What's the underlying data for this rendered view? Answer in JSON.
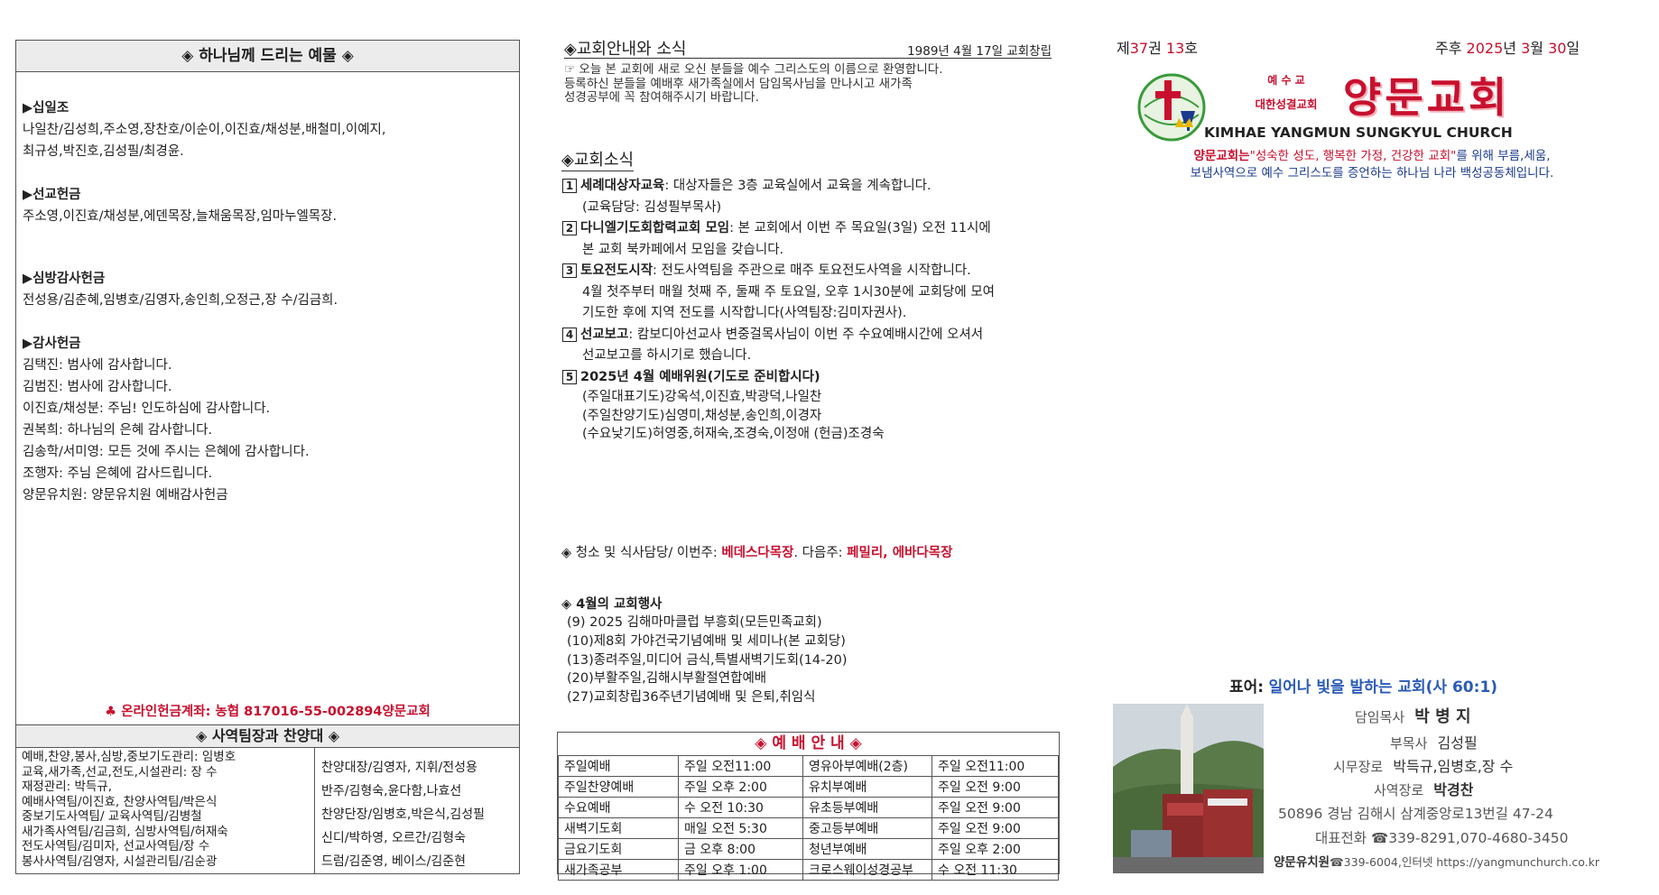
{
  "offering": {
    "title": "◈ 하나님께 드리는 예물 ◈",
    "sections": [
      {
        "heading": "▶십일조",
        "lines": [
          "나일찬/김성희,주소영,장찬호/이순이,이진효/채성분,배철미,이예지,",
          "최규성,박진호,김성필/최경윤."
        ]
      },
      {
        "heading": "▶선교헌금",
        "lines": [
          "주소영,이진효/채성분,에덴목장,늘채움목장,임마누엘목장."
        ]
      },
      {
        "heading": "▶심방감사헌금",
        "lines": [
          "전성용/김춘혜,임병호/김영자,송인희,오정근,장  수/김금희."
        ]
      },
      {
        "heading": "▶감사헌금",
        "lines": [
          "김택진: 범사에 감사합니다.",
          "김범진: 범사에 감사합니다.",
          "이진효/채성분: 주님! 인도하심에 감사합니다.",
          "권복희: 하나님의 은혜 감사합니다.",
          "김송학/서미영: 모든 것에 주시는 은혜에 감사합니다.",
          "조행자: 주님 은혜에 감사드립니다.",
          "양문유치원: 양문유치원 예배감사헌금"
        ]
      }
    ],
    "online_account": "♣ 온라인헌금계좌: 농협 817016-55-002894양문교회"
  },
  "ministry": {
    "title": "◈ 사역팀장과 찬양대 ◈",
    "left_lines": [
      "예배,찬양,봉사,심방,중보기도관리: 임병호",
      "교육,새가족,선교,전도,시설관리: 장  수",
      "재정관리: 박득규,",
      "예배사역팀/이진효,       찬양사역팀/박은식",
      "중보기도사역팀/            교육사역팀/김병철",
      "새가족사역팀/김금희,     심방사역팀/허재숙",
      "전도사역팀/김미자,         선교사역팀/장  수",
      "봉사사역팀/김영자,         시설관리팀/김순광"
    ],
    "right_lines": [
      "찬양대장/김영자, 지휘/전성용",
      "반주/김형숙,윤다함,나효선",
      "찬양단장/임병호,박은식,김성필",
      "신디/박하영,    오르간/김형숙",
      "드럼/김준영,    베이스/김준현"
    ]
  },
  "news": {
    "title": "◈교회안내와 소식",
    "founded": "1989년 4월 17일 교회창립",
    "welcome_lines": [
      "☞ 오늘 본 교회에 새로 오신 분들을 예수 그리스도의 이름으로 환영합니다.",
      "등록하신 분들을 예배후 새가족실에서 담임목사님을 만나시고 새가족",
      "성경공부에 꼭 참여해주시기 바랍니다."
    ],
    "sub_title": "◈교회소식",
    "items": [
      {
        "no": "1",
        "head": "세례대상자교육",
        "lines": [
          ": 대상자들은 3층 교육실에서 교육을 계속합니다.",
          "(교육담당: 김성필부목사)"
        ]
      },
      {
        "no": "2",
        "head": "다니엘기도회합력교회 모임",
        "lines": [
          ": 본 교회에서 이번 주 목요일(3일) 오전 11시에",
          "본 교회 북카페에서 모임을 갖습니다."
        ]
      },
      {
        "no": "3",
        "head": "토요전도시작",
        "lines": [
          ": 전도사역팀을 주관으로 매주 토요전도사역을 시작합니다.",
          "4월 첫주부터 매월 첫째 주, 둘째 주 토요일, 오후 1시30분에 교회당에 모여",
          "기도한 후에 지역 전도를 시작합니다(사역팀장:김미자권사)."
        ]
      },
      {
        "no": "4",
        "head": "선교보고",
        "lines": [
          ": 캄보디아선교사 변중걸목사님이 이번 주 수요예배시간에 오셔서",
          "선교보고를 하시기로 했습니다."
        ]
      },
      {
        "no": "5",
        "head": "2025년 4월 예배위원(기도로 준비합시다)",
        "lines": [
          "",
          "(주일대표기도)강옥석,이진효,박광덕,나일찬",
          "(주일찬양기도)심영미,채성분,송인희,이경자",
          "(수요낮기도)허영중,허재숙,조경숙,이정애 (헌금)조경숙"
        ]
      }
    ],
    "cleaning_label": "◈ 청소 및 식사담당/ 이번주:",
    "cleaning_this": "베데스다목장",
    "cleaning_next_label": ". 다음주:",
    "cleaning_next": "페밀리, 에바다목장",
    "events_title": "◈ 4월의 교회행사",
    "events": [
      "(9) 2025 김해마마클럽 부흥회(모든민족교회)",
      "(10)제8회 가야건국기념예배 및 세미나(본 교회당)",
      "(13)종려주일,미디어 금식,특별새벽기도회(14-20)",
      "(20)부활주일,김해시부활절연합예배",
      "(27)교회창립36주년기념예배 및 은퇴,취임식"
    ]
  },
  "worship": {
    "title": "◈ 예 배 안 내 ◈",
    "rows": [
      [
        "주일예배",
        "주일 오전11:00",
        "영유아부예배(2층)",
        "주일 오전11:00"
      ],
      [
        "주일찬양예배",
        "주일 오후 2:00",
        "유치부예배",
        "주일 오전 9:00"
      ],
      [
        "수요예배",
        "수 오전 10:30",
        "유초등부예배",
        "주일 오전 9:00"
      ],
      [
        "새벽기도회",
        "매일 오전 5:30",
        "중고등부예배",
        "주일 오전 9:00"
      ],
      [
        "금요기도회",
        "금 오후 8:00",
        "청년부예배",
        "주일 오후 2:00"
      ],
      [
        "새가족공부",
        "주일 오후 1:00",
        "크로스웨이성경공부",
        "수 오전 11:30"
      ]
    ]
  },
  "masthead": {
    "vol_pre": "제",
    "vol": "37",
    "vol_mid": "권 ",
    "issue": "13",
    "issue_post": "호",
    "date_pre": "주후 ",
    "year": "2025",
    "year_post": "년 ",
    "month": "3",
    "month_post": "월 ",
    "day": "30",
    "day_post": "일",
    "denom_top": "예  수  교",
    "denom_bottom": "대한성결교회",
    "church_name": "양문교회",
    "english_name": "KIMHAE YANGMUN SUNGKYUL CHURCH",
    "mission_name": "양문교회는",
    "mission_quote": "\"성숙한 성도, 행복한 가정, 건강한 교회\"",
    "mission_rest1": "를 위해 부름,세움,",
    "mission_line2": "보냄사역으로 예수 그리스도를 증언하는 하나님 나라 백성공동체입니다.",
    "motto_label": "표어:",
    "motto": "일어나 빛을 발하는 교회(사 60:1)"
  },
  "staff": {
    "senior_label": "담임목사",
    "senior": "박 병 지",
    "associate_label": "부목사",
    "associate": "김성필",
    "elders_label": "시무장로",
    "elders": "박득규,임병호,장  수",
    "ministry_elder_label": "사역장로",
    "ministry_elder": "박경찬",
    "address": "50896 경남 김해시 삼계중앙로13번길 47-24",
    "phone": "대표전화 ☎339-8291,070-4680-3450",
    "kinder_name": "양문유치원",
    "kinder_rest": "☎339-6004,인터넷 https://yangmunchurch.co.kr"
  },
  "colors": {
    "accent_red": "#c8102e",
    "accent_blue": "#1a3a8c",
    "border": "#555555",
    "header_bg": "#ececec"
  }
}
